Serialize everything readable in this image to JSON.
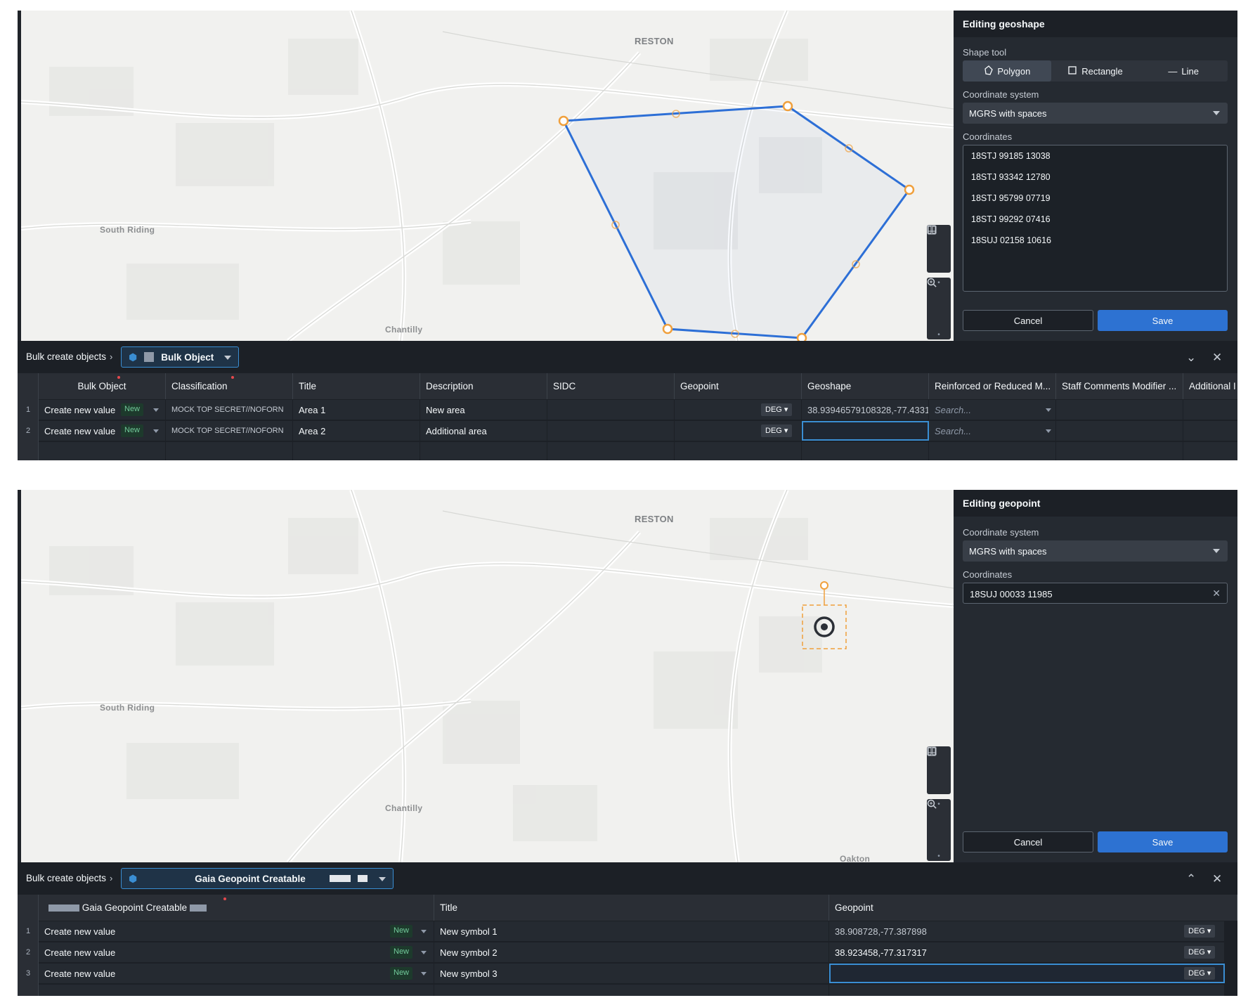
{
  "top": {
    "map_labels": {
      "reston": "RESTON",
      "south_riding": "South Riding",
      "chantilly": "Chantilly"
    },
    "panel": {
      "title": "Editing geoshape",
      "shape_tool_label": "Shape tool",
      "shape_tools": [
        "Polygon",
        "Rectangle",
        "Line"
      ],
      "active_tool": "Polygon",
      "coord_system_label": "Coordinate system",
      "coord_system_value": "MGRS with spaces",
      "coordinates_label": "Coordinates",
      "coordinates": [
        "18STJ 99185 13038",
        "18STJ 93342 12780",
        "18STJ 95799 07719",
        "18STJ 99292 07416",
        "18SUJ 02158 10616"
      ],
      "cancel": "Cancel",
      "save": "Save"
    },
    "bar": {
      "crumb": "Bulk create objects",
      "object_type": "Bulk Object"
    },
    "columns": [
      "Bulk Object",
      "Classification",
      "Title",
      "Description",
      "SIDC",
      "Geopoint",
      "Geoshape",
      "Reinforced or Reduced M...",
      "Staff Comments Modifier ...",
      "Additional I"
    ],
    "rows": [
      {
        "num": "1",
        "bulk": "Create new value",
        "tag": "New",
        "classification": "MOCK TOP SECRET//NOFORN",
        "title": "Area 1",
        "description": "New area",
        "sidc": "",
        "geopoint_unit": "DEG",
        "geoshape": "38.93946579108328,-77.4331",
        "reinforced": "Search..."
      },
      {
        "num": "2",
        "bulk": "Create new value",
        "tag": "New",
        "classification": "MOCK TOP SECRET//NOFORN",
        "title": "Area 2",
        "description": "Additional area",
        "sidc": "",
        "geopoint_unit": "DEG",
        "geoshape": "",
        "reinforced": "Search..."
      }
    ],
    "colors": {
      "polygon_line": "#2d6fd6",
      "vertex": "#f0a03c"
    }
  },
  "bottom": {
    "map_labels": {
      "reston": "RESTON",
      "south_riding": "South Riding",
      "chantilly": "Chantilly",
      "oakton": "Oakton"
    },
    "panel": {
      "title": "Editing geopoint",
      "coord_system_label": "Coordinate system",
      "coord_system_value": "MGRS with spaces",
      "coordinates_label": "Coordinates",
      "coordinate_value": "18SUJ 00033 11985",
      "cancel": "Cancel",
      "save": "Save"
    },
    "bar": {
      "crumb": "Bulk create objects",
      "object_type": "Gaia Geopoint Creatable"
    },
    "columns": [
      "Gaia Geopoint Creatable",
      "Title",
      "Geopoint"
    ],
    "rows": [
      {
        "num": "1",
        "bulk": "Create new value",
        "tag": "New",
        "title": "New symbol 1",
        "geopoint": "38.908728,-77.387898",
        "unit": "DEG"
      },
      {
        "num": "2",
        "bulk": "Create new value",
        "tag": "New",
        "title": "New symbol 2",
        "geopoint": "38.923458,-77.317317",
        "unit": "DEG"
      },
      {
        "num": "3",
        "bulk": "Create new value",
        "tag": "New",
        "title": "New symbol 3",
        "geopoint": "",
        "unit": "DEG"
      }
    ]
  }
}
